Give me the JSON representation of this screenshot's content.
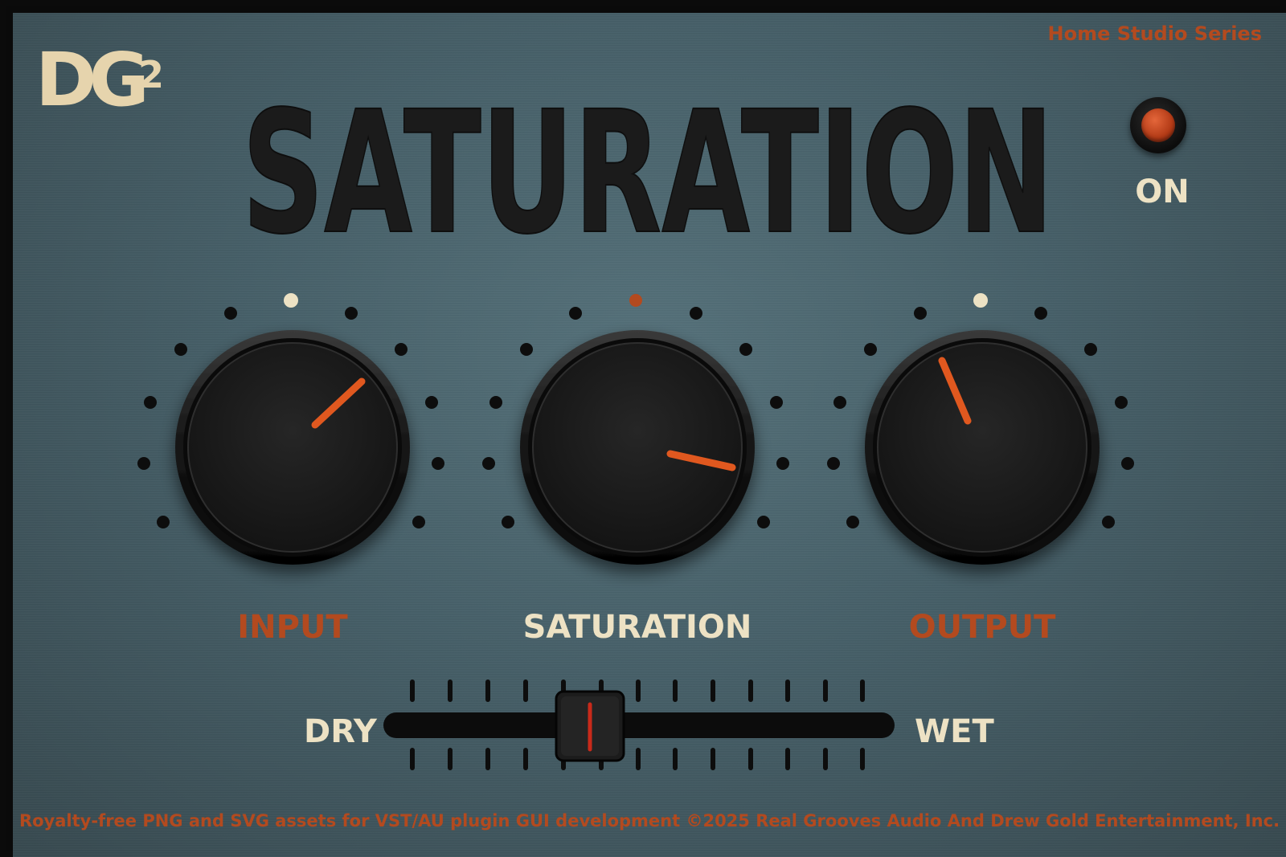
{
  "header": {
    "series": "Home Studio Series",
    "logo_text": "DG",
    "logo_sup": "2",
    "title": "SATURATION"
  },
  "power": {
    "label": "ON",
    "state": "on",
    "indicator_color": "#c9431c"
  },
  "knobs": [
    {
      "label": "INPUT",
      "label_color": "#b34a1f",
      "marker_color": "#ede2c4",
      "indicator_color": "#e0581f"
    },
    {
      "label": "SATURATION",
      "label_color": "#ede2c4",
      "marker_color": "#b34a1f",
      "indicator_color": "#e0581f"
    },
    {
      "label": "OUTPUT",
      "label_color": "#b34a1f",
      "marker_color": "#ede2c4",
      "indicator_color": "#e0581f"
    }
  ],
  "mix": {
    "left_label": "DRY",
    "right_label": "WET",
    "handle_indicator_color": "#c92a1a",
    "value": 0.41
  },
  "footer": {
    "text": "Royalty-free PNG and SVG assets for VST/AU plugin GUI development  ©2025 Real Grooves Audio And Drew Gold Entertainment, Inc."
  }
}
